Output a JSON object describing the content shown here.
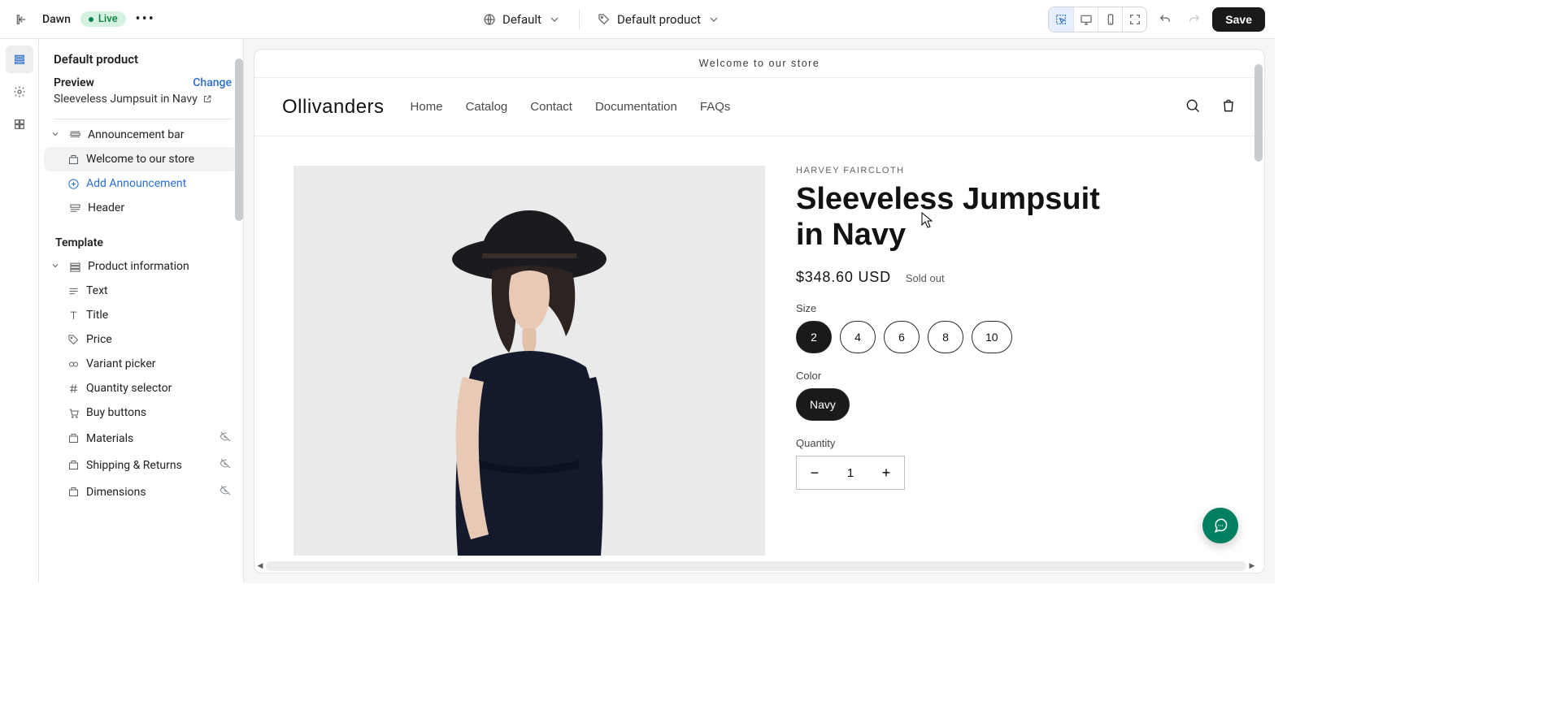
{
  "topbar": {
    "theme_name": "Dawn",
    "status_badge": "Live",
    "template_picker": "Default",
    "resource_picker": "Default product",
    "save_label": "Save"
  },
  "sidebar": {
    "title": "Default product",
    "preview_label": "Preview",
    "change_label": "Change",
    "preview_product": "Sleeveless Jumpsuit in Navy",
    "sections": {
      "announcement_bar": "Announcement bar",
      "announcement_welcome": "Welcome to our store",
      "add_announcement": "Add Announcement",
      "header": "Header"
    },
    "template_label": "Template",
    "product_info_label": "Product information",
    "blocks": {
      "text": "Text",
      "title": "Title",
      "price": "Price",
      "variant_picker": "Variant picker",
      "quantity_selector": "Quantity selector",
      "buy_buttons": "Buy buttons",
      "materials": "Materials",
      "shipping": "Shipping & Returns",
      "dimensions": "Dimensions"
    }
  },
  "store": {
    "announcement": "Welcome to our store",
    "brand": "Ollivanders",
    "nav": {
      "home": "Home",
      "catalog": "Catalog",
      "contact": "Contact",
      "documentation": "Documentation",
      "faqs": "FAQs"
    },
    "product": {
      "vendor": "HARVEY FAIRCLOTH",
      "title": "Sleeveless Jumpsuit in Navy",
      "price": "$348.60 USD",
      "sold_out": "Sold out",
      "size_label": "Size",
      "sizes": {
        "s2": "2",
        "s4": "4",
        "s6": "6",
        "s8": "8",
        "s10": "10"
      },
      "color_label": "Color",
      "colors": {
        "navy": "Navy"
      },
      "quantity_label": "Quantity",
      "quantity_value": "1"
    }
  }
}
